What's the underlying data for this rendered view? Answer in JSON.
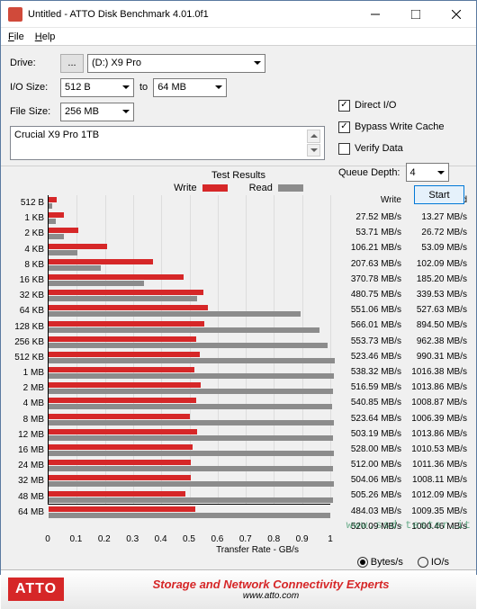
{
  "window": {
    "title": "Untitled - ATTO Disk Benchmark 4.01.0f1"
  },
  "menu": {
    "file": "File",
    "help": "Help"
  },
  "form": {
    "drive_label": "Drive:",
    "browse": "...",
    "drive_value": "(D:) X9 Pro",
    "io_label": "I/O Size:",
    "io_from": "512 B",
    "to": "to",
    "io_to": "64 MB",
    "fs_label": "File Size:",
    "fs_value": "256 MB"
  },
  "opts": {
    "direct_io": "Direct I/O",
    "bypass": "Bypass Write Cache",
    "verify": "Verify Data",
    "qd_label": "Queue Depth:",
    "qd_value": "4",
    "start": "Start"
  },
  "device": "Crucial X9 Pro 1TB",
  "results": {
    "title": "Test Results",
    "write": "Write",
    "read": "Read",
    "xlabel": "Transfer Rate - GB/s",
    "write_hdr": "Write",
    "read_hdr": "Read",
    "bytes": "Bytes/s",
    "ios": "IO/s"
  },
  "footer": {
    "logo": "ATTO",
    "t1": "Storage and Network Connectivity Experts",
    "t2": "www.atto.com"
  },
  "watermark": "www.ssd-tester.it",
  "chart_data": {
    "type": "bar",
    "xlabel": "Transfer Rate - GB/s",
    "xlim": [
      0,
      1
    ],
    "xticks": [
      0,
      0.1,
      0.2,
      0.3,
      0.4,
      0.5,
      0.6,
      0.7,
      0.8,
      0.9,
      1
    ],
    "categories": [
      "512 B",
      "1 KB",
      "2 KB",
      "4 KB",
      "8 KB",
      "16 KB",
      "32 KB",
      "64 KB",
      "128 KB",
      "256 KB",
      "512 KB",
      "1 MB",
      "2 MB",
      "4 MB",
      "8 MB",
      "12 MB",
      "16 MB",
      "24 MB",
      "32 MB",
      "48 MB",
      "64 MB"
    ],
    "series": [
      {
        "name": "Write",
        "unit": "MB/s",
        "values": [
          27.52,
          53.71,
          106.21,
          207.63,
          370.78,
          480.75,
          551.06,
          566.01,
          553.73,
          523.46,
          538.32,
          516.59,
          540.85,
          523.64,
          503.19,
          528,
          512,
          504.06,
          505.26,
          484.03,
          520.09
        ]
      },
      {
        "name": "Read",
        "unit": "MB/s",
        "values": [
          13.27,
          26.72,
          53.09,
          102.09,
          185.2,
          339.53,
          527.63,
          894.5,
          962.38,
          990.31,
          1016.38,
          1013.86,
          1008.87,
          1006.39,
          1013.86,
          1010.53,
          1011.36,
          1008.11,
          1012.09,
          1009.35,
          1000.46
        ]
      }
    ]
  }
}
